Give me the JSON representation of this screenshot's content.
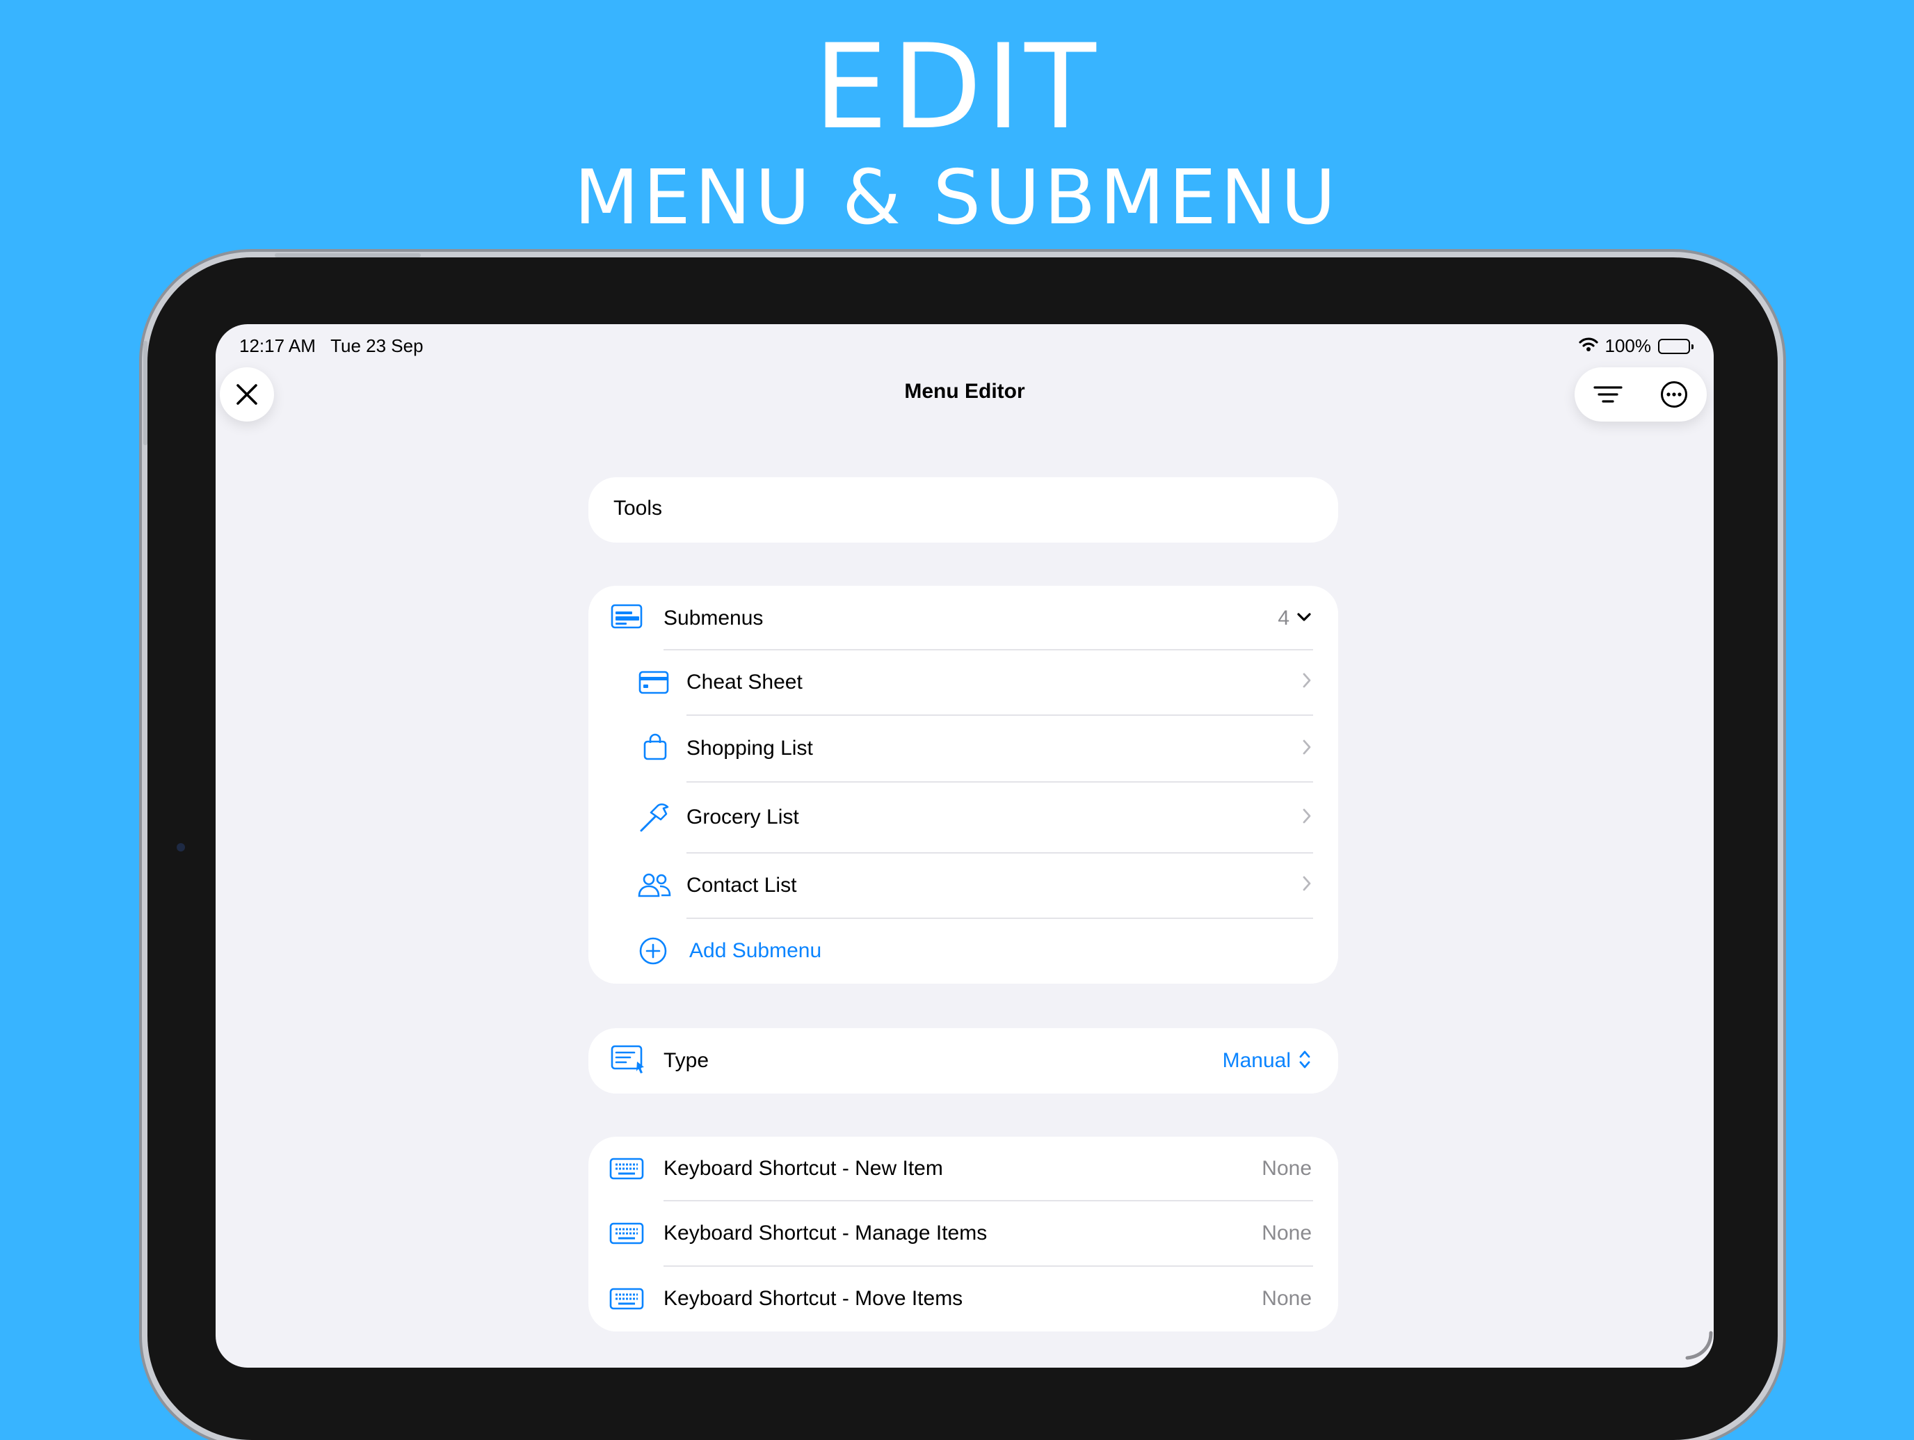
{
  "headline": {
    "line1": "EDIT",
    "line2": "MENU & SUBMENU"
  },
  "status_bar": {
    "time": "12:17 AM",
    "date": "Tue 23 Sep",
    "battery": "100%"
  },
  "nav": {
    "title": "Menu Editor"
  },
  "menu_name": {
    "value": "Tools"
  },
  "submenus": {
    "label": "Submenus",
    "count": "4",
    "items": [
      {
        "label": "Cheat Sheet",
        "icon": "card-icon"
      },
      {
        "label": "Shopping List",
        "icon": "bag-icon"
      },
      {
        "label": "Grocery List",
        "icon": "hammer-icon"
      },
      {
        "label": "Contact List",
        "icon": "people-icon"
      }
    ],
    "add_label": "Add Submenu"
  },
  "type": {
    "label": "Type",
    "value": "Manual"
  },
  "shortcuts": [
    {
      "label": "Keyboard Shortcut - New Item",
      "value": "None"
    },
    {
      "label": "Keyboard Shortcut - Manage Items",
      "value": "None"
    },
    {
      "label": "Keyboard Shortcut - Move Items",
      "value": "None"
    }
  ],
  "colors": {
    "background": "#38b4ff",
    "accent": "#0a84ff",
    "screen": "#f2f2f7"
  }
}
